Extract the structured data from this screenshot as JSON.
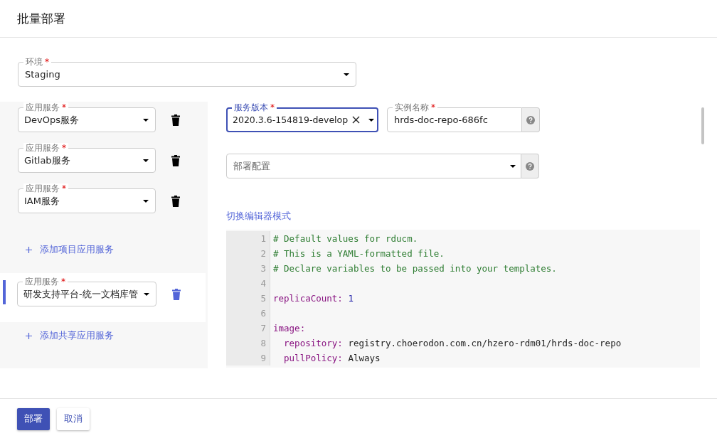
{
  "title": "批量部署",
  "environment": {
    "label": "环境",
    "required_mark": "*",
    "value": "Staging"
  },
  "services": [
    {
      "label": "应用服务",
      "required_mark": "*",
      "value": "DevOps服务",
      "selected": false
    },
    {
      "label": "应用服务",
      "required_mark": "*",
      "value": "Gitlab服务",
      "selected": false
    },
    {
      "label": "应用服务",
      "required_mark": "*",
      "value": "IAM服务",
      "selected": false
    }
  ],
  "add_project_service": "添加项目应用服务",
  "shared_services": [
    {
      "label": "应用服务",
      "required_mark": "*",
      "value": "研发支持平台-统一文档库管",
      "selected": true
    }
  ],
  "add_shared_service": "添加共享应用服务",
  "version": {
    "label": "服务版本",
    "required_mark": "*",
    "value": "2020.3.6-154819-develop",
    "focused": true
  },
  "instance": {
    "label": "实例名称",
    "required_mark": "*",
    "value": "hrds-doc-repo-686fc"
  },
  "deploy_config": {
    "placeholder": "部署配置"
  },
  "editor_mode_link": "切换编辑器模式",
  "code_lines": [
    {
      "number": "1",
      "tokens": [
        {
          "kind": "comment",
          "text": "# Default values for rducm."
        }
      ]
    },
    {
      "number": "2",
      "tokens": [
        {
          "kind": "comment",
          "text": "# This is a YAML-formatted file."
        }
      ]
    },
    {
      "number": "3",
      "tokens": [
        {
          "kind": "comment",
          "text": "# Declare variables to be passed into your templates."
        }
      ]
    },
    {
      "number": "4"
    },
    {
      "number": "5",
      "tokens": [
        {
          "kind": "key",
          "text": "replicaCount:"
        },
        {
          "kind": "number",
          "text": "1"
        }
      ]
    },
    {
      "number": "6"
    },
    {
      "number": "7",
      "tokens": [
        {
          "kind": "key",
          "text": "image:"
        }
      ]
    },
    {
      "number": "8",
      "tokens": [
        {
          "kind": "key",
          "text": "  repository:"
        },
        {
          "kind": "plain",
          "text": "registry.choerodon.com.cn/hzero-rdm01/hrds-doc-repo"
        }
      ]
    },
    {
      "number": "9",
      "tokens": [
        {
          "kind": "key",
          "text": "  pullPolicy:"
        },
        {
          "kind": "plain",
          "text": "Always"
        }
      ]
    }
  ],
  "buttons": [
    {
      "label": "部署",
      "kind": "primary"
    },
    {
      "label": "取消",
      "kind": "secondary"
    }
  ]
}
